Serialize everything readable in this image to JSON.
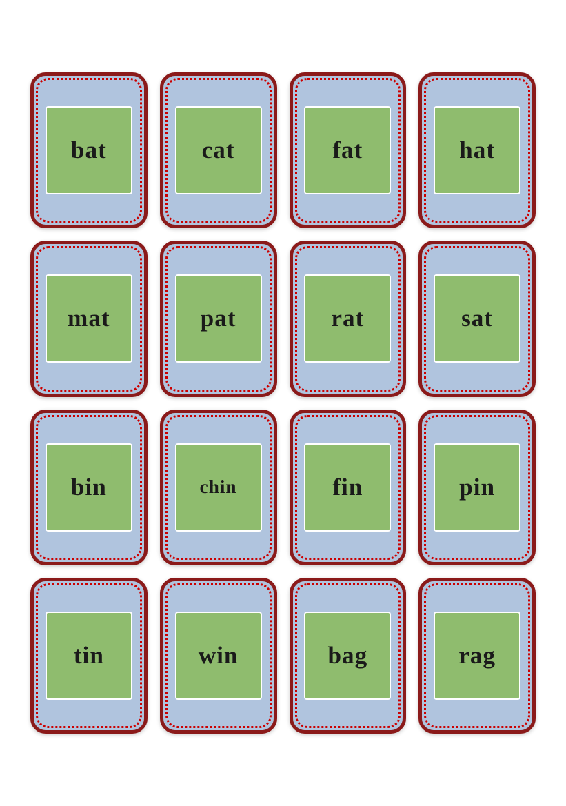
{
  "cards": [
    {
      "id": 1,
      "word": "bat",
      "long": false
    },
    {
      "id": 2,
      "word": "cat",
      "long": false
    },
    {
      "id": 3,
      "word": "fat",
      "long": false
    },
    {
      "id": 4,
      "word": "hat",
      "long": false
    },
    {
      "id": 5,
      "word": "mat",
      "long": false
    },
    {
      "id": 6,
      "word": "pat",
      "long": false
    },
    {
      "id": 7,
      "word": "rat",
      "long": false
    },
    {
      "id": 8,
      "word": "sat",
      "long": false
    },
    {
      "id": 9,
      "word": "bin",
      "long": false
    },
    {
      "id": 10,
      "word": "chin",
      "long": true
    },
    {
      "id": 11,
      "word": "fin",
      "long": false
    },
    {
      "id": 12,
      "word": "pin",
      "long": false
    },
    {
      "id": 13,
      "word": "tin",
      "long": false
    },
    {
      "id": 14,
      "word": "win",
      "long": false
    },
    {
      "id": 15,
      "word": "bag",
      "long": false
    },
    {
      "id": 16,
      "word": "rag",
      "long": false
    }
  ]
}
